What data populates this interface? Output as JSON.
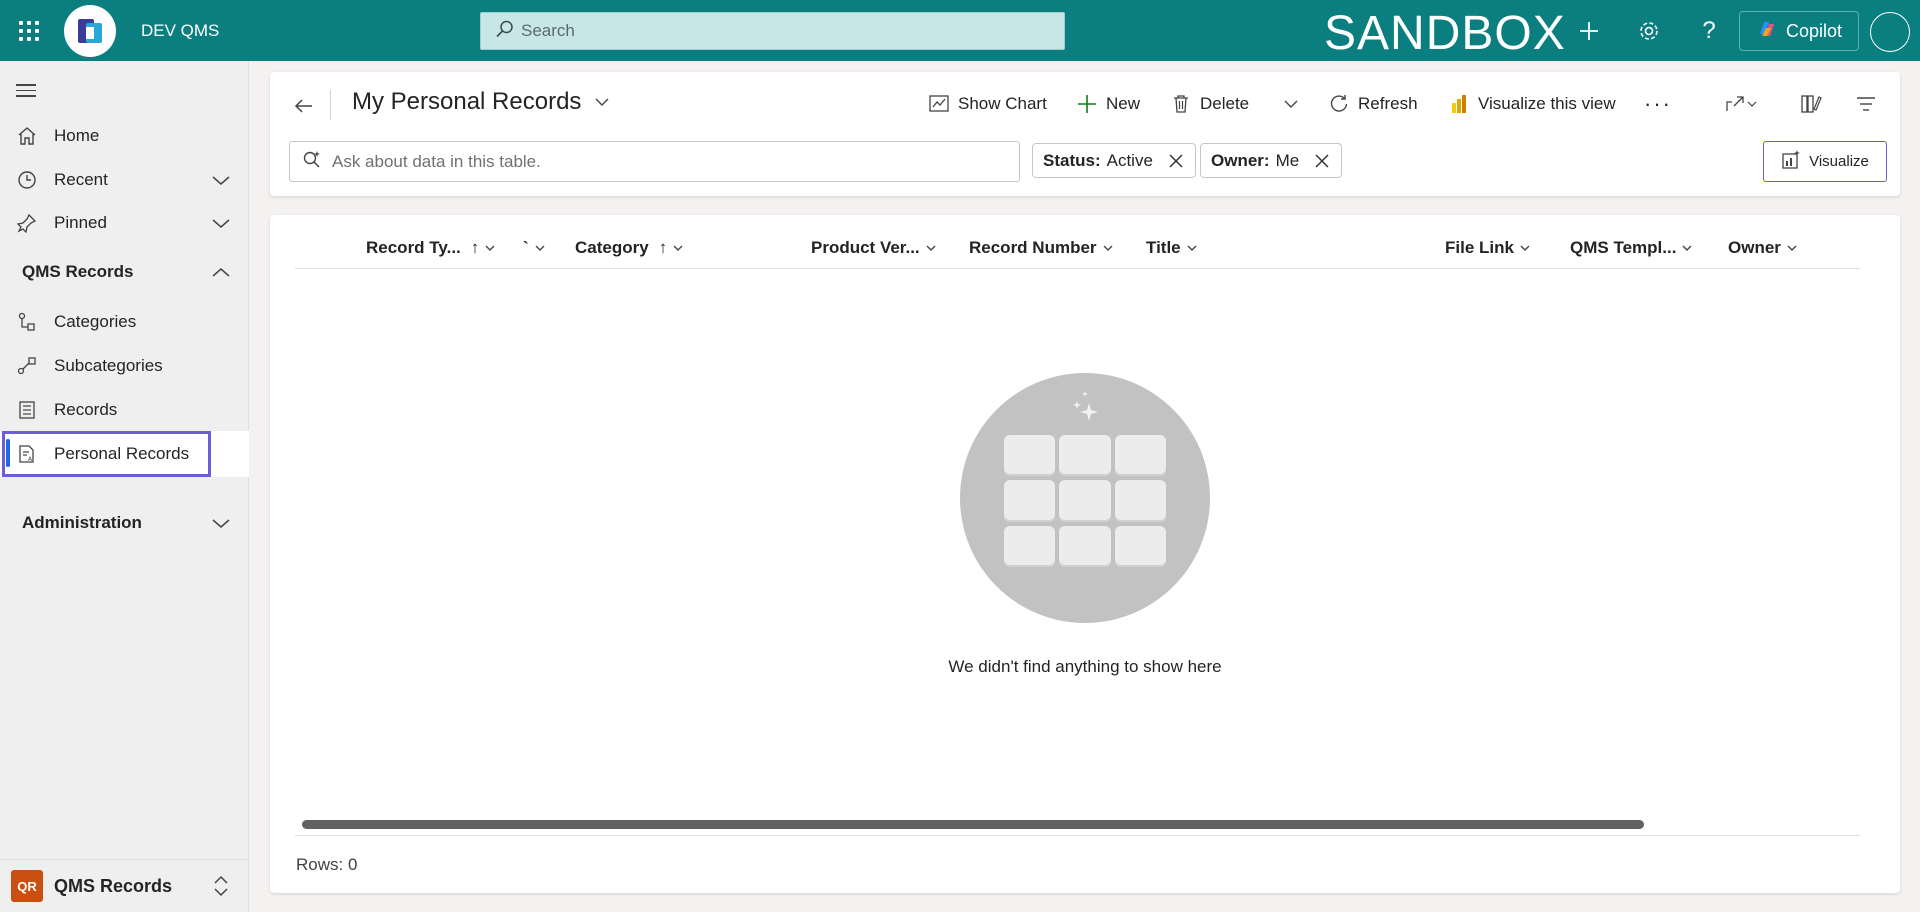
{
  "topbar": {
    "app_name": "DEV QMS",
    "search_placeholder": "Search",
    "environment": "SANDBOX",
    "copilot_label": "Copilot",
    "bg_color": "#0b7f80"
  },
  "sidebar": {
    "items": [
      {
        "label": "Home",
        "icon": "home-icon"
      },
      {
        "label": "Recent",
        "icon": "clock-icon"
      },
      {
        "label": "Pinned",
        "icon": "pin-icon"
      }
    ],
    "group_qms": "QMS Records",
    "group_items": [
      {
        "label": "Categories",
        "icon": "category-icon"
      },
      {
        "label": "Subcategories",
        "icon": "subcategory-icon"
      },
      {
        "label": "Records",
        "icon": "records-icon"
      },
      {
        "label": "Personal Records",
        "icon": "personal-records-icon",
        "selected": true
      }
    ],
    "group_admin": "Administration",
    "area_badge": "QR",
    "area_name": "QMS Records"
  },
  "header": {
    "title": "My Personal Records",
    "commands": {
      "show_chart": "Show Chart",
      "new": "New",
      "delete": "Delete",
      "refresh": "Refresh",
      "visualize_view": "Visualize this view"
    },
    "ask_placeholder": "Ask about data in this table.",
    "filters": [
      {
        "key": "Status:",
        "value": "Active"
      },
      {
        "key": "Owner:",
        "value": "Me"
      }
    ],
    "visualize_label": "Visualize"
  },
  "grid": {
    "columns": [
      {
        "label": "Record Ty...",
        "sort": "↑"
      },
      {
        "label": "`",
        "sort": ""
      },
      {
        "label": "Category",
        "sort": "↑"
      },
      {
        "label": "Product Ver...",
        "sort": ""
      },
      {
        "label": "Record Number",
        "sort": ""
      },
      {
        "label": "Title",
        "sort": ""
      },
      {
        "label": "File Link",
        "sort": ""
      },
      {
        "label": "QMS Templ...",
        "sort": ""
      },
      {
        "label": "Owner",
        "sort": ""
      }
    ],
    "empty_message": "We didn't find anything to show here",
    "rows_label": "Rows: 0"
  }
}
